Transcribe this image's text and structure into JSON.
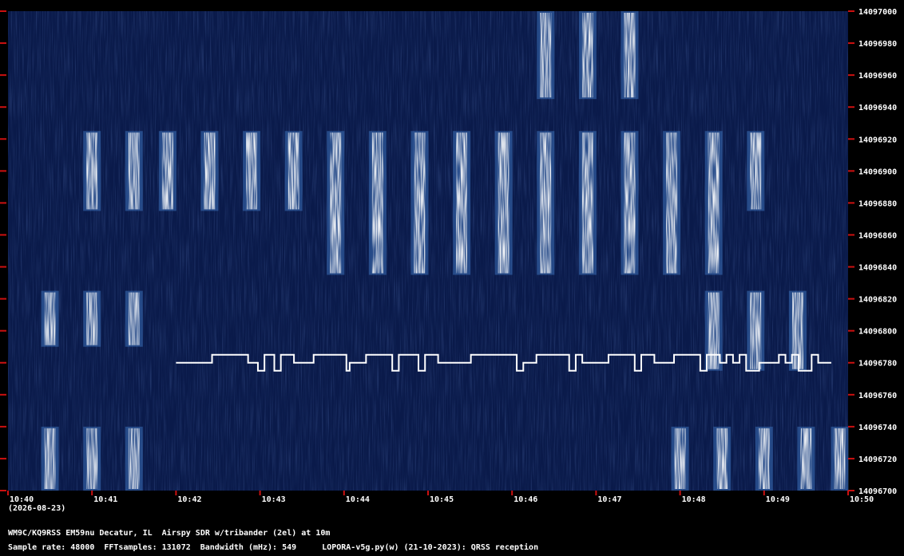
{
  "date_label": "(2026-08-23)",
  "info_line": "WM9C/KQ9RSS EM59nu Decatur, IL  Airspy SDR w/tribander (2el) at 10m",
  "params": {
    "sample_rate": "Sample rate: 48000",
    "fft_samples": "FFTsamples: 131072",
    "bandwidth": "Bandwidth (mHz): 549",
    "software": "LOPORA-v5g.py(w) (21-10-2023): QRSS reception"
  },
  "colors": {
    "background": "#0a1a4a",
    "tick": "#cc1010",
    "signal": "#ffffff"
  },
  "chart_data": {
    "type": "heatmap",
    "x_ticks": [
      "10:40",
      "10:41",
      "10:42",
      "10:43",
      "10:44",
      "10:45",
      "10:46",
      "10:47",
      "10:48",
      "10:49",
      "10:50"
    ],
    "y_ticks": [
      "14097000",
      "14096980",
      "14096960",
      "14096940",
      "14096920",
      "14096900",
      "14096880",
      "14096860",
      "14096840",
      "14096820",
      "14096800",
      "14096780",
      "14096760",
      "14096740",
      "14096720",
      "14096700"
    ],
    "ylim": [
      14096700,
      14097000
    ],
    "xlim": [
      "10:40",
      "10:50"
    ],
    "signals": [
      {
        "band": [
          14096825,
          14096790
        ],
        "times": [
          "10:40.5",
          "10:41.0",
          "10:41.5"
        ]
      },
      {
        "band": [
          14096925,
          14096875
        ],
        "times": [
          "10:41.0",
          "10:41.5",
          "10:41.9",
          "10:42.4",
          "10:42.9",
          "10:43.4"
        ]
      },
      {
        "band": [
          14096925,
          14096835
        ],
        "times": [
          "10:43.9",
          "10:44.4",
          "10:44.9",
          "10:45.4",
          "10:45.9",
          "10:46.4",
          "10:46.9",
          "10:47.4",
          "10:47.9",
          "10:48.4"
        ]
      },
      {
        "band": [
          14096925,
          14096875
        ],
        "times": [
          "10:48.9"
        ]
      },
      {
        "band": [
          14097000,
          14096945
        ],
        "times": [
          "10:46.4",
          "10:46.9",
          "10:47.4"
        ]
      },
      {
        "band": [
          14096825,
          14096775
        ],
        "times": [
          "10:48.4",
          "10:48.9",
          "10:49.4"
        ]
      },
      {
        "band": [
          14096740,
          14096700
        ],
        "times": [
          "10:40.5",
          "10:41.0",
          "10:41.5",
          "10:48.0",
          "10:48.5",
          "10:49.0",
          "10:49.5",
          "10:49.9"
        ]
      }
    ],
    "trace": {
      "levels": [
        14096780,
        14096785,
        14096775
      ],
      "xrange": [
        "10:42.0",
        "10:49.8"
      ]
    }
  }
}
